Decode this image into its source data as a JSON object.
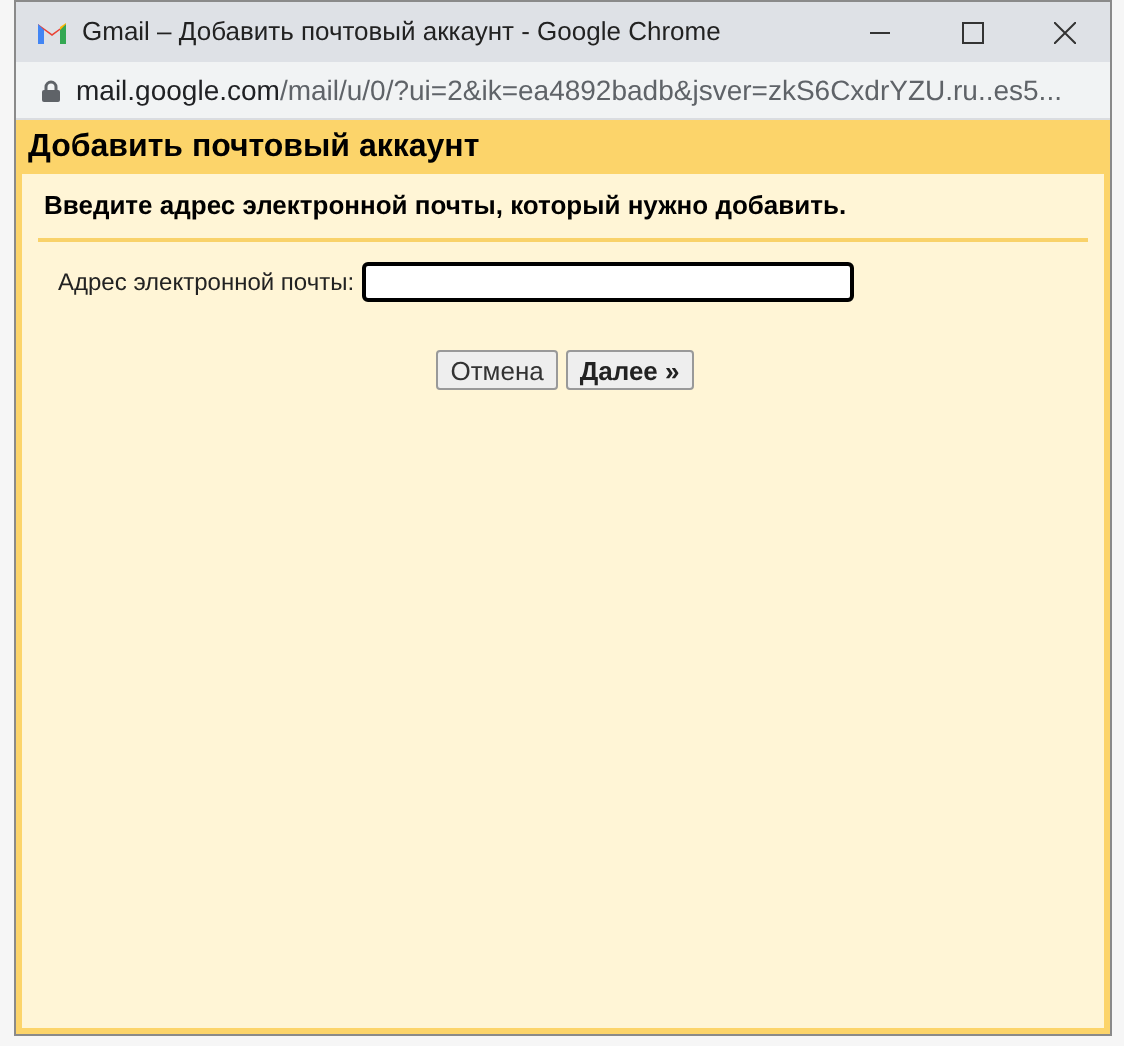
{
  "window": {
    "title": "Gmail – Добавить почтовый аккаунт - Google Chrome"
  },
  "address_bar": {
    "host": "mail.google.com",
    "path": "/mail/u/0/?ui=2&ik=ea4892badb&jsver=zkS6CxdrYZU.ru..es5..."
  },
  "dialog": {
    "title": "Добавить почтовый аккаунт",
    "instruction": "Введите адрес электронной почты, который нужно добавить.",
    "field_label": "Адрес электронной почты:",
    "buttons": [
      {
        "label": "Отмена",
        "kind": "secondary"
      },
      {
        "label": "Далее »",
        "kind": "primary"
      }
    ]
  }
}
